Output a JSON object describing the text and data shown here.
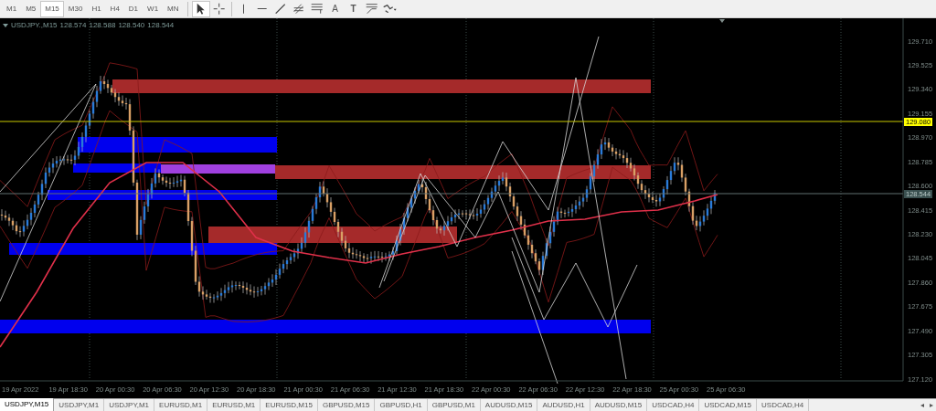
{
  "toolbar": {
    "timeframes": [
      {
        "label": "M1",
        "selected": false
      },
      {
        "label": "M5",
        "selected": false
      },
      {
        "label": "M15",
        "selected": true
      },
      {
        "label": "M30",
        "selected": false
      },
      {
        "label": "H1",
        "selected": false
      },
      {
        "label": "H4",
        "selected": false
      },
      {
        "label": "D1",
        "selected": false
      },
      {
        "label": "W1",
        "selected": false
      },
      {
        "label": "MN",
        "selected": false
      }
    ],
    "tools": [
      {
        "kind": "cursor",
        "selected": true
      },
      {
        "kind": "crosshair",
        "selected": false
      },
      {
        "kind": "vline",
        "selected": false
      },
      {
        "kind": "hline",
        "selected": false
      },
      {
        "kind": "trendline",
        "selected": false
      },
      {
        "kind": "channel",
        "selected": false
      },
      {
        "kind": "equidistant",
        "selected": false
      },
      {
        "kind": "text",
        "label": "A",
        "selected": false
      },
      {
        "kind": "label",
        "label": "T",
        "selected": false
      },
      {
        "kind": "fibo",
        "selected": false
      },
      {
        "kind": "arrows",
        "selected": false
      }
    ]
  },
  "chart": {
    "symbol": "USDJPY.,M15",
    "quotes": [
      "128.574",
      "128.588",
      "128.540",
      "128.544"
    ],
    "price_labels": [
      "129.710",
      "129.525",
      "129.340",
      "129.155",
      "128.970",
      "128.785",
      "128.600",
      "128.415",
      "128.230",
      "128.045",
      "127.860",
      "127.675",
      "127.490",
      "127.305",
      "127.120"
    ],
    "price_tags": [
      {
        "label": "129.080",
        "kind": "hline"
      },
      {
        "label": "128.544",
        "kind": "bid"
      }
    ],
    "time_labels": [
      "19 Apr 2022",
      "19 Apr 18:30",
      "20 Apr 00:30",
      "20 Apr 06:30",
      "20 Apr 12:30",
      "20 Apr 18:30",
      "21 Apr 00:30",
      "21 Apr 06:30",
      "21 Apr 12:30",
      "21 Apr 18:30",
      "22 Apr 00:30",
      "22 Apr 06:30",
      "22 Apr 12:30",
      "22 Apr 18:30",
      "25 Apr 00:30",
      "25 Apr 06:30"
    ]
  },
  "tabs": [
    {
      "label": "USDJPY,M15",
      "selected": true
    },
    {
      "label": "USDJPY,M1",
      "selected": false
    },
    {
      "label": "USDJPY,M1",
      "selected": false
    },
    {
      "label": "EURUSD,M1",
      "selected": false
    },
    {
      "label": "EURUSD,M1",
      "selected": false
    },
    {
      "label": "EURUSD,M15",
      "selected": false
    },
    {
      "label": "GBPUSD,M15",
      "selected": false
    },
    {
      "label": "GBPUSD,H1",
      "selected": false
    },
    {
      "label": "GBPUSD,M1",
      "selected": false
    },
    {
      "label": "AUDUSD,M15",
      "selected": false
    },
    {
      "label": "AUDUSD,H1",
      "selected": false
    },
    {
      "label": "AUDUSD,M15",
      "selected": false
    },
    {
      "label": "USDCAD,H4",
      "selected": false
    },
    {
      "label": "USDCAD,M15",
      "selected": false
    },
    {
      "label": "USDCAD,H4",
      "selected": false
    }
  ],
  "tab_scroll": [
    "◂",
    "▸"
  ]
}
